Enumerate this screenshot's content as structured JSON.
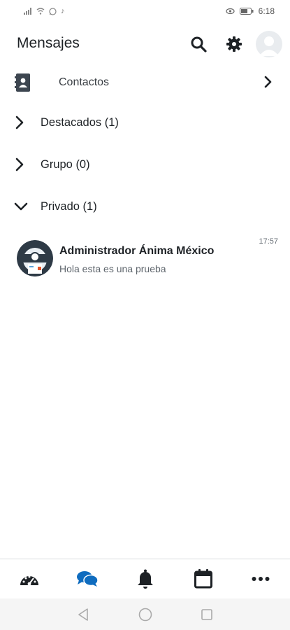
{
  "status_bar": {
    "time": "6:18",
    "left_icons": [
      "signal-icon",
      "wifi-icon",
      "whatsapp-icon",
      "tiktok-icon"
    ],
    "right_icons": [
      "eye-comfort-icon",
      "battery-icon"
    ]
  },
  "header": {
    "title": "Mensajes",
    "search_icon": "search-icon",
    "settings_icon": "gear-icon",
    "avatar_icon": "user-avatar"
  },
  "contacts": {
    "label": "Contactos"
  },
  "sections": [
    {
      "label": "Destacados (1)",
      "expanded": false
    },
    {
      "label": "Grupo (0)",
      "expanded": false
    },
    {
      "label": "Privado (1)",
      "expanded": true
    }
  ],
  "conversations": [
    {
      "name": "Administrador Ánima México",
      "preview": "Hola esta es una prueba",
      "time": "17:57"
    }
  ],
  "bottom_nav": [
    {
      "icon": "dashboard-icon",
      "active": false
    },
    {
      "icon": "messages-icon",
      "active": true
    },
    {
      "icon": "bell-icon",
      "active": false
    },
    {
      "icon": "calendar-icon",
      "active": false
    },
    {
      "icon": "more-icon",
      "active": false
    }
  ],
  "colors": {
    "active": "#0f6cbf",
    "icon": "#1d2125"
  }
}
